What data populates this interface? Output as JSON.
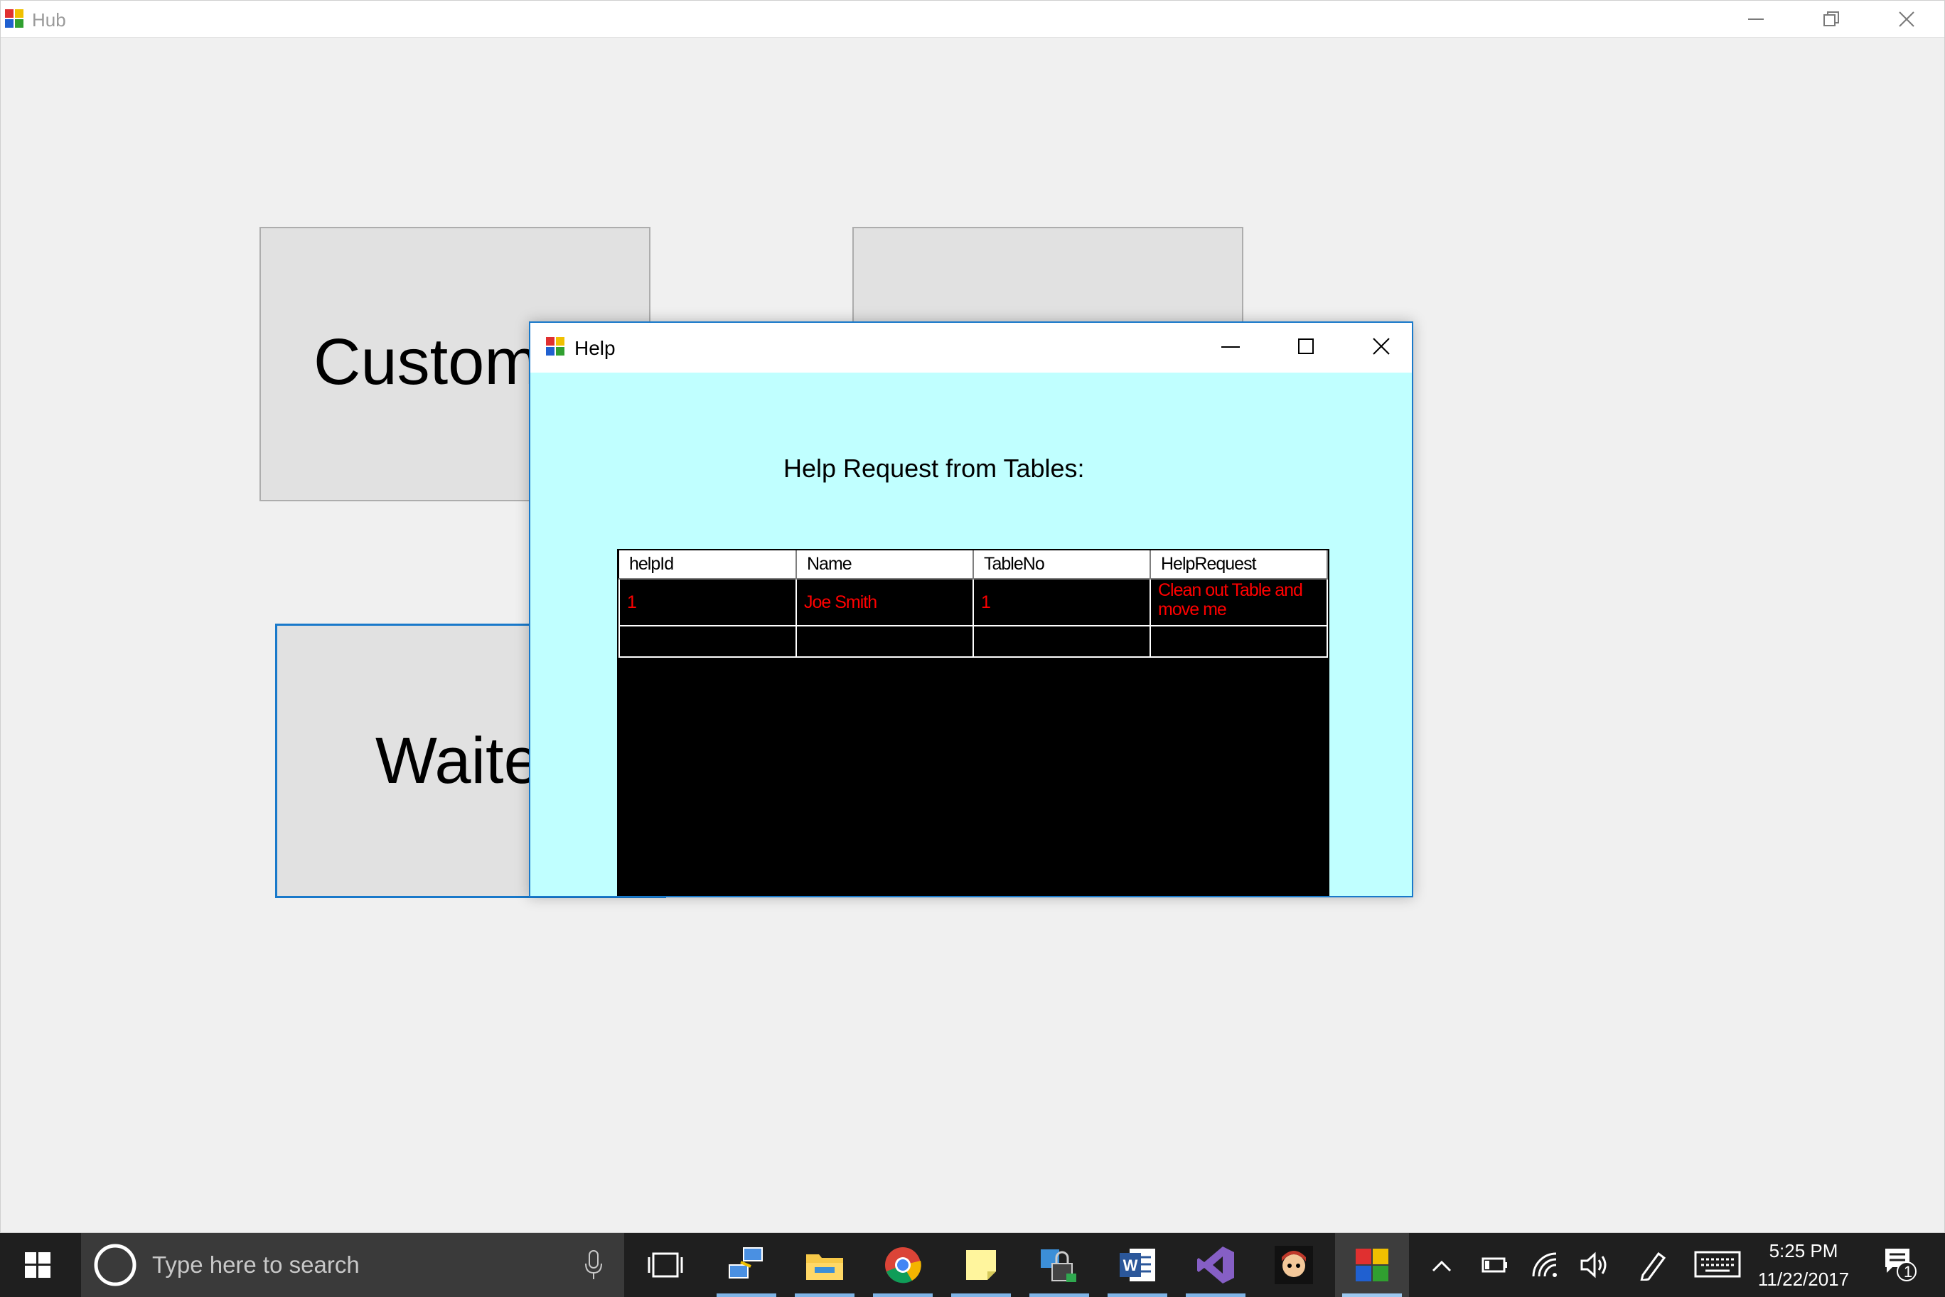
{
  "hub": {
    "title": "Hub",
    "customer_label": "Customer",
    "waiter_label": "Waiter"
  },
  "help": {
    "title": "Help",
    "heading": "Help Request from Tables:",
    "columns": [
      "helpId",
      "Name",
      "TableNo",
      "HelpRequest"
    ],
    "rows": [
      [
        "1",
        "Joe Smith",
        "1",
        "Clean out Table and move me"
      ]
    ]
  },
  "taskbar": {
    "search_placeholder": "Type here to search",
    "time": "5:25 PM",
    "date": "11/22/2017",
    "notification_count": "1"
  },
  "colors": {
    "dialog_bg": "#c0ffff",
    "grid_bg": "#000000",
    "grid_text": "#ff0000",
    "accent": "#1979ca"
  }
}
